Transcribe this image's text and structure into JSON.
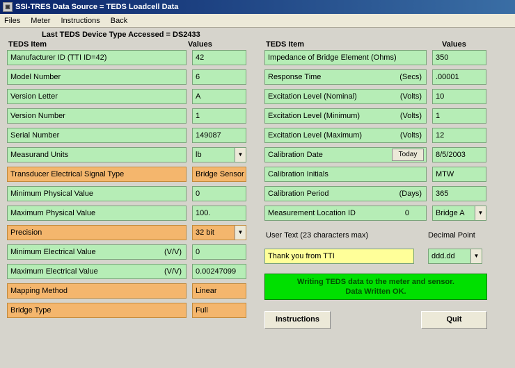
{
  "window": {
    "title": "SSI-TRES  Data Source = TEDS Loadcell Data"
  },
  "menu": {
    "files": "Files",
    "meter": "Meter",
    "instructions": "Instructions",
    "back": "Back"
  },
  "subtitle": "Last TEDS Device Type Accessed = DS2433",
  "headers": {
    "teds_item": "TEDS Item",
    "values": "Values"
  },
  "left": [
    {
      "label": "Manufacturer ID   (TTI  ID=42)",
      "value": "42"
    },
    {
      "label": "Model Number",
      "value": "6"
    },
    {
      "label": "Version Letter",
      "value": "A"
    },
    {
      "label": "Version Number",
      "value": "1"
    },
    {
      "label": "Serial Number",
      "value": "149087"
    },
    {
      "label": "Measurand Units",
      "value": "lb",
      "dropdown": true
    },
    {
      "label": "Transducer Electrical Signal Type",
      "value": "Bridge Sensor",
      "orange": true
    },
    {
      "label": "Minimum Physical Value",
      "value": "0"
    },
    {
      "label": "Maximum Physical Value",
      "value": "100."
    },
    {
      "label": "Precision",
      "value": "32 bit",
      "dropdown": true,
      "orange": true
    },
    {
      "label": "Minimum Electrical Value",
      "unit": "(V/V)",
      "value": "0"
    },
    {
      "label": "Maximum Electrical Value",
      "unit": "(V/V)",
      "value": "0.00247099"
    },
    {
      "label": "Mapping Method",
      "value": "Linear",
      "orange": true
    },
    {
      "label": "Bridge Type",
      "value": "Full",
      "orange": true
    }
  ],
  "right": [
    {
      "label": "Impedance of Bridge Element (Ohms)",
      "value": "350"
    },
    {
      "label": "Response Time",
      "unit": "(Secs)",
      "value": ".00001"
    },
    {
      "label": "Excitation Level (Nominal)",
      "unit": "(Volts)",
      "value": "10"
    },
    {
      "label": "Excitation Level (Minimum)",
      "unit": "(Volts)",
      "value": "1"
    },
    {
      "label": "Excitation Level (Maximum)",
      "unit": "(Volts)",
      "value": "12"
    },
    {
      "label": "Calibration Date",
      "today": true,
      "value": "8/5/2003"
    },
    {
      "label": "Calibration Initials",
      "value": "MTW"
    },
    {
      "label": "Calibration Period",
      "unit": "(Days)",
      "value": "365"
    },
    {
      "label": "Measurement Location ID",
      "inline_num": "0",
      "value": "Bridge A",
      "dropdown": true
    }
  ],
  "user_text": {
    "label": "User Text (23 characters max)",
    "value": "Thank you from TTI"
  },
  "decimal_point": {
    "label": "Decimal Point",
    "value": "ddd.dd"
  },
  "status": {
    "line1": "Writing TEDS data to the meter and sensor.",
    "line2": "Data Written OK."
  },
  "buttons": {
    "today": "Today",
    "instructions": "Instructions",
    "quit": "Quit"
  }
}
